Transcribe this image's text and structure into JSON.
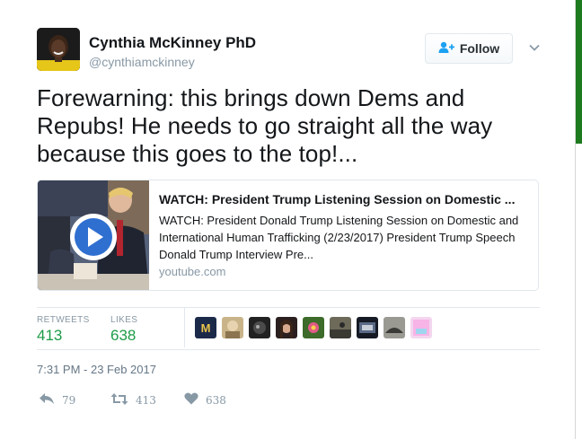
{
  "user": {
    "name": "Cynthia McKinney PhD",
    "handle": "@cynthiamckinney"
  },
  "follow_button": {
    "label": "Follow",
    "icon": "add-user-icon"
  },
  "menu_icon": "chevron-down-icon",
  "tweet": {
    "text": "Forewarning: this brings down Dems and Repubs! He needs to go straight all the way because this goes to the top!..."
  },
  "link_card": {
    "title": "WATCH: President Trump Listening Session on Domestic ...",
    "description": "WATCH: President Donald Trump Listening Session on Domestic and International Human Trafficking (2/23/2017) President Trump Speech Donald Trump Interview Pre...",
    "domain": "youtube.com",
    "thumbnail_icon": "play-icon"
  },
  "stats": {
    "retweets_label": "RETWEETS",
    "retweets_value": "413",
    "likes_label": "LIKES",
    "likes_value": "638"
  },
  "likers_count": 9,
  "timestamp": "7:31 PM - 23 Feb 2017",
  "actions": {
    "reply_count": "79",
    "retweet_count": "413",
    "like_count": "638"
  },
  "colors": {
    "stat_green": "#1c9b47",
    "muted": "#8899a6",
    "play_blue": "#2f6fd0",
    "side_green": "#1e7a1e"
  }
}
